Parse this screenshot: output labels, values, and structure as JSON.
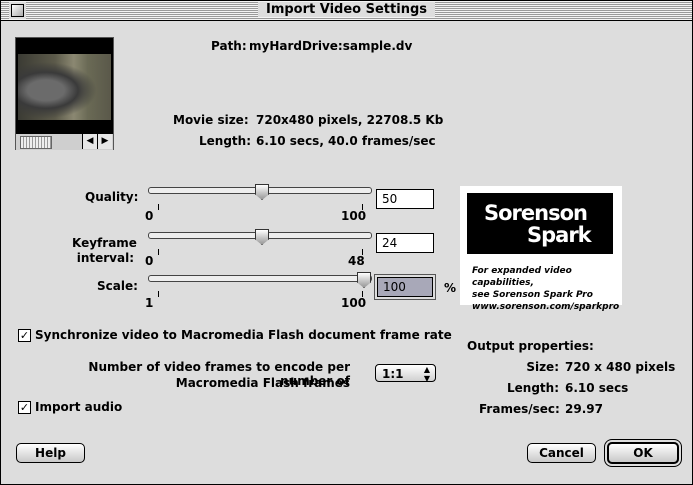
{
  "window": {
    "title": "Import Video Settings"
  },
  "preview": {
    "alt": "video preview frame"
  },
  "info": {
    "path_label": "Path:",
    "path_value": "myHardDrive:sample.dv",
    "movie_size_label": "Movie size:",
    "movie_size_value": "720x480 pixels, 22708.5 Kb",
    "length_label": "Length:",
    "length_value": "6.10 secs, 40.0 frames/sec"
  },
  "sliders": {
    "quality": {
      "label": "Quality:",
      "value": "50",
      "min": "0",
      "max": "100",
      "level": 0.5
    },
    "keyframe": {
      "label_line1": "Keyframe",
      "label_line2": "interval:",
      "value": "24",
      "min": "0",
      "max": "48",
      "level": 0.5
    },
    "scale": {
      "label": "Scale:",
      "value": "100",
      "min": "1",
      "max": "100",
      "unit": "%",
      "level": 1.0
    }
  },
  "logo": {
    "line1": "Sorenson",
    "line2": "Spark",
    "tagline1": "For expanded video capabilities,",
    "tagline2": "see Sorenson Spark Pro",
    "tagline3": "www.sorenson.com/sparkpro"
  },
  "options": {
    "sync_label": "Synchronize video to Macromedia Flash document frame rate",
    "sync_checked": true,
    "frames_label_line1": "Number of video frames to encode per number of",
    "frames_label_line2": "Macromedia Flash frames",
    "frames_value": "1:1",
    "audio_label": "Import audio",
    "audio_checked": true
  },
  "output": {
    "heading": "Output properties:",
    "size_label": "Size:",
    "size_value": "720 x 480 pixels",
    "length_label": "Length:",
    "length_value": "6.10 secs",
    "fps_label": "Frames/sec:",
    "fps_value": "29.97"
  },
  "buttons": {
    "help": "Help",
    "cancel": "Cancel",
    "ok": "OK"
  }
}
